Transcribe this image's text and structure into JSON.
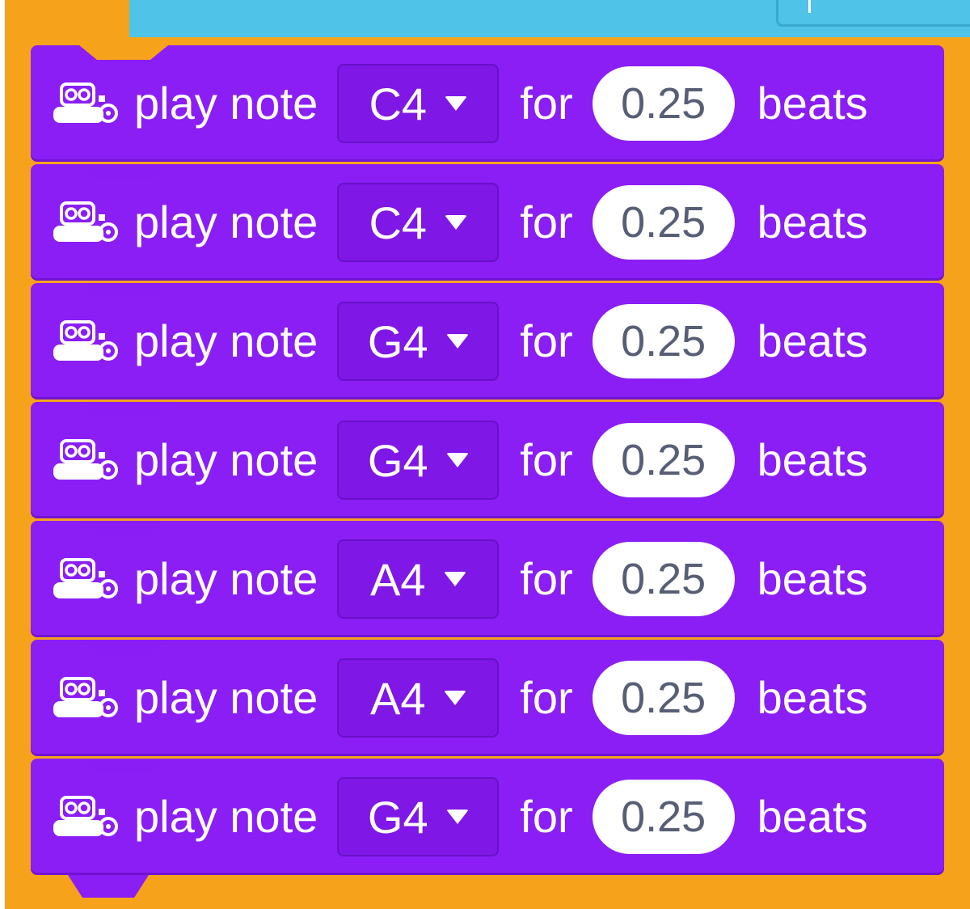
{
  "colors": {
    "block_purple": "#8a1ef5",
    "dropdown_purple": "#7f17e6",
    "frame_orange": "#f6a31b",
    "top_blue": "#4fc3e8",
    "pill_text": "#575e75"
  },
  "icon": "robot-extension-icon",
  "blocks": [
    {
      "play_label": "play note",
      "note": "C4",
      "for_label": "for",
      "beats_value": "0.25",
      "beats_label": "beats"
    },
    {
      "play_label": "play note",
      "note": "C4",
      "for_label": "for",
      "beats_value": "0.25",
      "beats_label": "beats"
    },
    {
      "play_label": "play note",
      "note": "G4",
      "for_label": "for",
      "beats_value": "0.25",
      "beats_label": "beats"
    },
    {
      "play_label": "play note",
      "note": "G4",
      "for_label": "for",
      "beats_value": "0.25",
      "beats_label": "beats"
    },
    {
      "play_label": "play note",
      "note": "A4",
      "for_label": "for",
      "beats_value": "0.25",
      "beats_label": "beats"
    },
    {
      "play_label": "play note",
      "note": "A4",
      "for_label": "for",
      "beats_value": "0.25",
      "beats_label": "beats"
    },
    {
      "play_label": "play note",
      "note": "G4",
      "for_label": "for",
      "beats_value": "0.25",
      "beats_label": "beats"
    }
  ]
}
